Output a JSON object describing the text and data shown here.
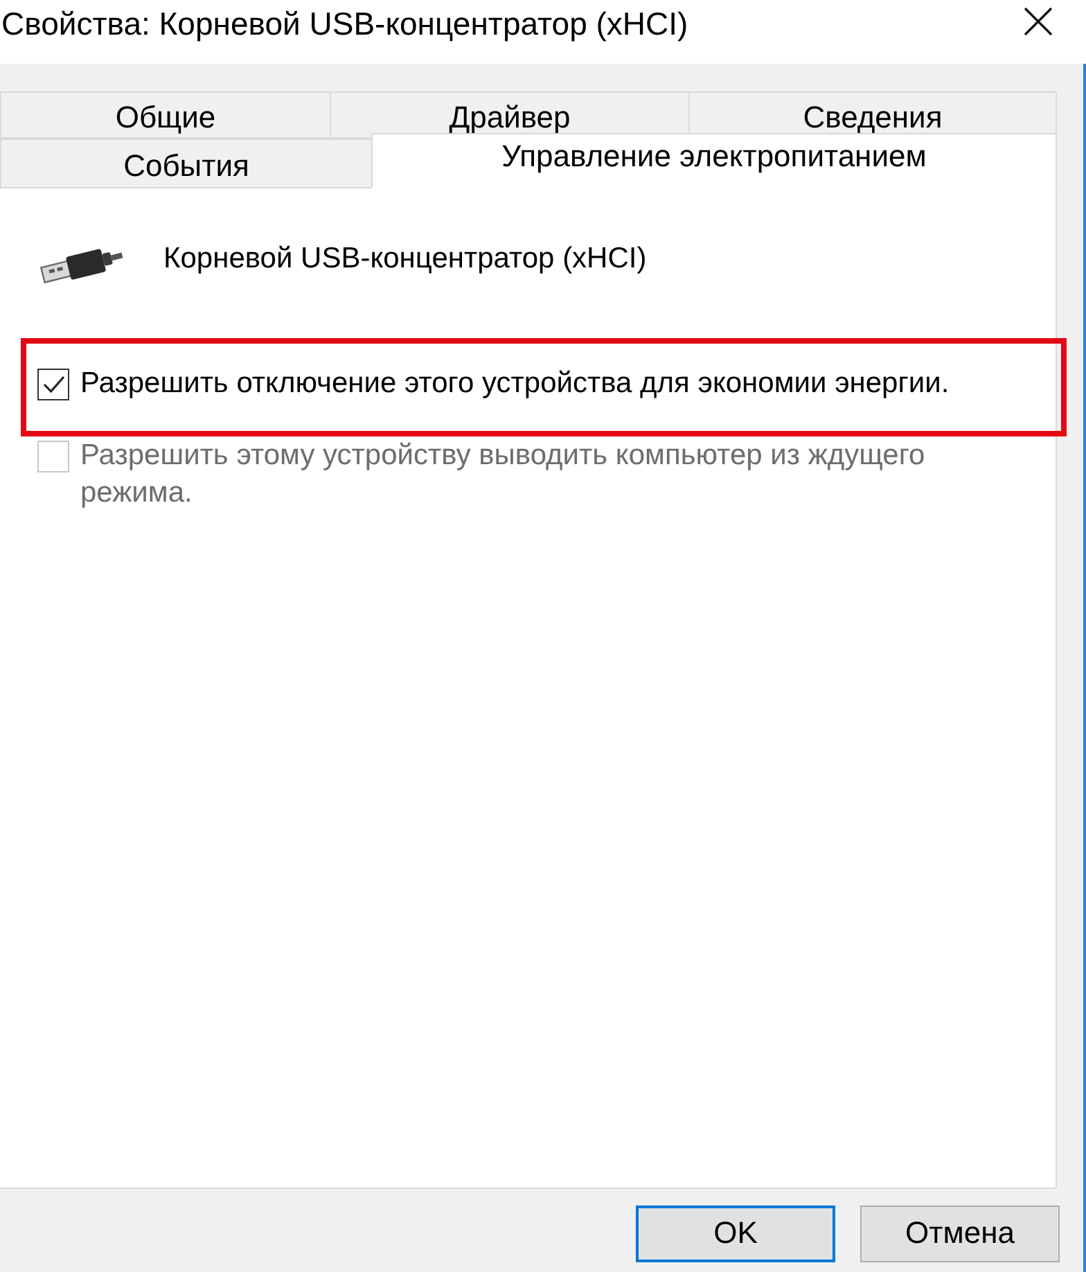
{
  "window": {
    "title": "Свойства: Корневой USB-концентратор (xHCI)"
  },
  "tab_rows": [
    {
      "tabs": [
        {
          "label": "Общие",
          "selected": false
        },
        {
          "label": "Драйвер",
          "selected": false
        },
        {
          "label": "Сведения",
          "selected": false
        }
      ]
    },
    {
      "tabs": [
        {
          "label": "События",
          "selected": false
        },
        {
          "label": "Управление электропитанием",
          "selected": true
        }
      ]
    }
  ],
  "device": {
    "name": "Корневой USB-концентратор (xHCI)"
  },
  "options": [
    {
      "label": "Разрешить отключение этого устройства для экономии энергии.",
      "checked": true,
      "disabled": false,
      "highlighted": true
    },
    {
      "label": "Разрешить этому устройству выводить компьютер из ждущего режима.",
      "checked": false,
      "disabled": true,
      "highlighted": false
    }
  ],
  "buttons": [
    {
      "label": "OK",
      "default": true
    },
    {
      "label": "Отмена",
      "default": false
    }
  ]
}
